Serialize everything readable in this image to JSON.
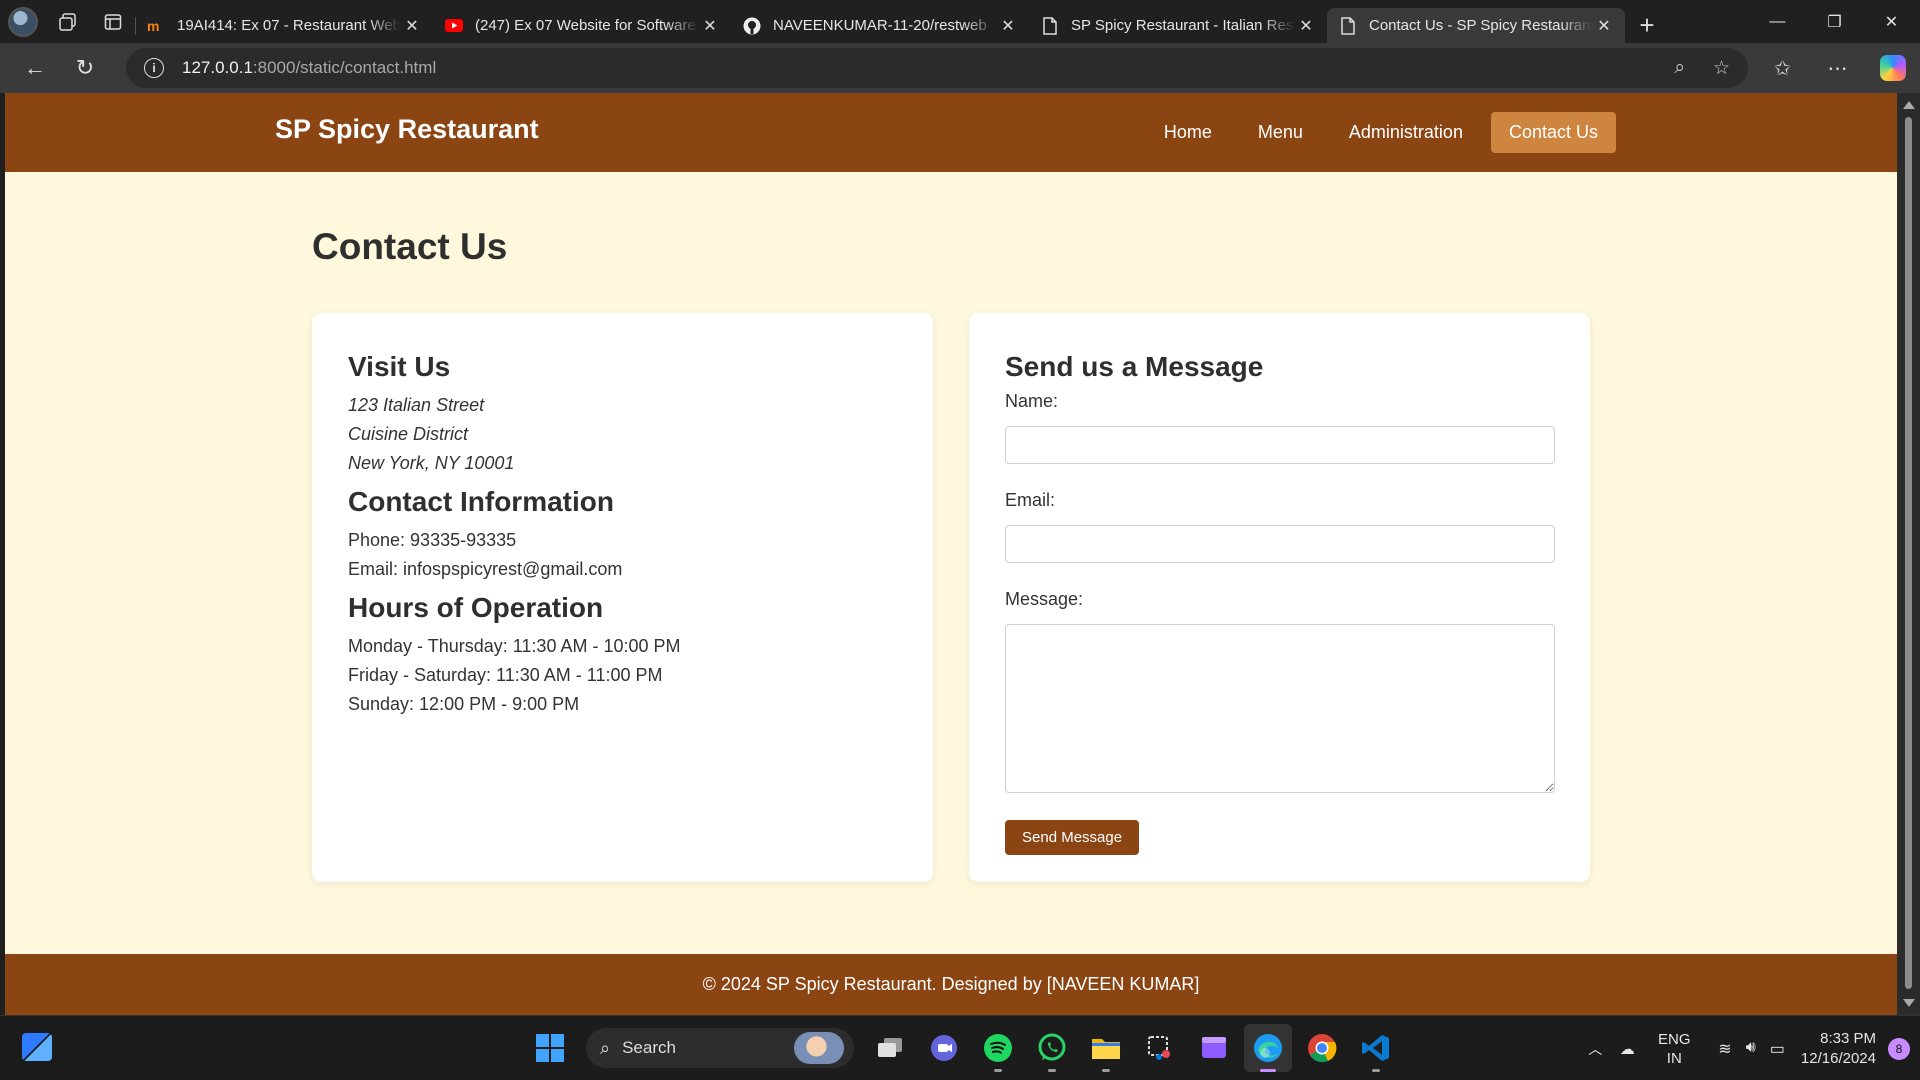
{
  "browser": {
    "tabs": [
      {
        "title": "19AI414: Ex 07 - Restaurant Website",
        "favicon": "moodle-icon"
      },
      {
        "title": "(247) Ex 07 Website for Software Company",
        "favicon": "youtube-icon"
      },
      {
        "title": "NAVEENKUMAR-11-20/restweb",
        "favicon": "github-icon"
      },
      {
        "title": "SP Spicy Restaurant - Italian Restaurant",
        "favicon": "page-icon"
      },
      {
        "title": "Contact Us - SP Spicy Restaurant",
        "favicon": "page-icon",
        "active": true
      }
    ],
    "url_host": "127.0.0.1",
    "url_path": ":8000/static/contact.html"
  },
  "site": {
    "brand": "SP Spicy Restaurant",
    "nav": [
      "Home",
      "Menu",
      "Administration",
      "Contact Us"
    ],
    "active_nav": "Contact Us",
    "page_title": "Contact Us",
    "visit": {
      "heading": "Visit Us",
      "lines": [
        "123 Italian Street",
        "Cuisine District",
        "New York, NY 10001"
      ]
    },
    "contact": {
      "heading": "Contact Information",
      "phone": "Phone: 93335-93335",
      "email": "Email: infospspicyrest@gmail.com"
    },
    "hours": {
      "heading": "Hours of Operation",
      "lines": [
        "Monday - Thursday: 11:30 AM - 10:00 PM",
        "Friday - Saturday: 11:30 AM - 11:00 PM",
        "Sunday: 12:00 PM - 9:00 PM"
      ]
    },
    "form": {
      "heading": "Send us a Message",
      "name_label": "Name:",
      "email_label": "Email:",
      "message_label": "Message:",
      "name_value": "",
      "email_value": "",
      "message_value": "",
      "submit_label": "Send Message"
    },
    "footer": "© 2024 SP Spicy Restaurant. Designed by [NAVEEN KUMAR]",
    "colors": {
      "primary": "#8b4513",
      "accent": "#cd853f",
      "background": "#fff8dc"
    }
  },
  "taskbar": {
    "search_label": "Search",
    "lang_line1": "ENG",
    "lang_line2": "IN",
    "time": "8:33 PM",
    "date": "12/16/2024",
    "notification_count": "8"
  }
}
